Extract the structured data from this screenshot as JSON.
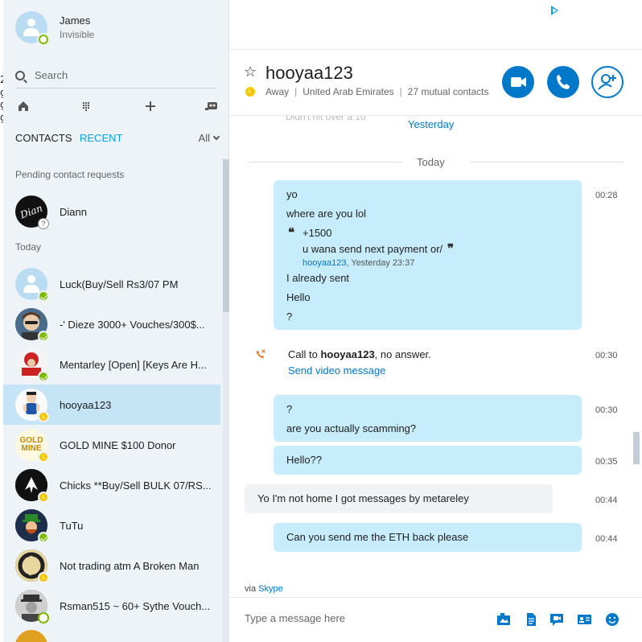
{
  "background_fragments": [
    "2",
    "g",
    "g",
    "g"
  ],
  "profile": {
    "name": "James",
    "status": "Invisible"
  },
  "search": {
    "placeholder": "Search"
  },
  "tabs": {
    "contacts": "CONTACTS",
    "recent": "RECENT",
    "filter": "All"
  },
  "sections": {
    "pending": "Pending contact requests",
    "today": "Today"
  },
  "pending_contacts": [
    {
      "name": "Diann",
      "avatar_text": "Dian"
    }
  ],
  "recent_contacts": [
    {
      "name": "Luck(Buy/Sell Rs3/07 PM",
      "status": "online"
    },
    {
      "name": "-' Dieze 3000+ Vouches/300$...",
      "status": "online"
    },
    {
      "name": "Mentarley [Open] [Keys Are H...",
      "status": "online"
    },
    {
      "name": "hooyaa123",
      "status": "away"
    },
    {
      "name": "GOLD MINE $100 Donor",
      "status": "away",
      "avatar_text": "GOLD MINE"
    },
    {
      "name": "Chicks **Buy/Sell BULK 07/RS...",
      "status": "away"
    },
    {
      "name": "TuTu",
      "status": "online"
    },
    {
      "name": "Not trading atm A Broken Man",
      "status": "away"
    },
    {
      "name": "Rsman515 ~ 60+ Sythe Vouch...",
      "status": "online"
    }
  ],
  "conversation": {
    "title": "hooyaa123",
    "presence": "Away",
    "location": "United Arab Emirates",
    "mutual": "27 mutual contacts"
  },
  "chat": {
    "yesterday_fragment": "Didn't hit over a 10",
    "yesterday_link": "Yesterday",
    "today_divider": "Today",
    "msg1": {
      "lines": [
        "yo",
        "where are you lol"
      ],
      "quote": {
        "line1": "+1500",
        "line2": "u wana send next payment or/",
        "author": "hooyaa123",
        "when": ", Yesterday 23:37"
      },
      "after": [
        "I already sent",
        "Hello",
        "?"
      ],
      "time": "00:28"
    },
    "call": {
      "prefix": "Call to ",
      "who": "hooyaa123",
      "suffix": ", no answer.",
      "link": "Send video message",
      "time": "00:30"
    },
    "msg2": {
      "lines": [
        "?",
        "are you actually scamming?"
      ],
      "time": "00:30"
    },
    "msg3": {
      "text": "Hello??",
      "time": "00:35"
    },
    "msg4": {
      "text": "Yo I'm not home I got messages by metareley",
      "time": "00:44"
    },
    "msg5": {
      "text": "Can you send me the ETH back please",
      "time": "00:44"
    }
  },
  "footer": {
    "via": "via ",
    "via_link": "Skype",
    "placeholder": "Type a message here"
  },
  "colors": {
    "accent": "#0078ca",
    "link": "#00a2e8",
    "online": "#7fba00",
    "away": "#fdc400",
    "bubble_out": "#c7edfc",
    "bubble_in": "#f0f3f5"
  },
  "icons": [
    "home-icon",
    "dialpad-icon",
    "plus-icon",
    "bot-icon",
    "star-icon",
    "video-icon",
    "phone-icon",
    "add-contact-icon",
    "missed-call-icon",
    "media-icon",
    "file-icon",
    "video-message-icon",
    "contact-card-icon",
    "emoticon-icon",
    "ad-choices-icon"
  ]
}
